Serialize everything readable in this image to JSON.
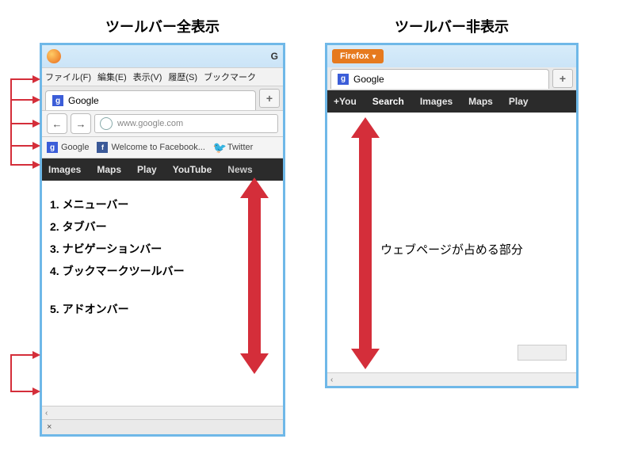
{
  "headings": {
    "left": "ツールバー全表示",
    "right": "ツールバー非表示"
  },
  "leftWindow": {
    "titlebar": {
      "rightLetter": "G"
    },
    "menubar": [
      "ファイル(F)",
      "編集(E)",
      "表示(V)",
      "履歴(S)",
      "ブックマーク"
    ],
    "tab": {
      "label": "Google",
      "newTab": "+"
    },
    "navbar": {
      "back": "←",
      "forward": "→",
      "url": "www.google.com"
    },
    "bookmarks": [
      {
        "icon": "g",
        "label": "Google"
      },
      {
        "icon": "fb",
        "label": "Welcome to Facebook..."
      },
      {
        "icon": "tw",
        "label": "Twitter"
      }
    ],
    "blackbar": [
      "Images",
      "Maps",
      "Play",
      "YouTube",
      "News"
    ],
    "annotations": [
      "1. メニューバー",
      "2. タブバー",
      "3. ナビゲーションバー",
      "4. ブックマークツールバー",
      "5. アドオンバー"
    ],
    "addonbar": {
      "close": "×"
    },
    "scroll": {
      "left": "‹"
    }
  },
  "rightWindow": {
    "ffButton": "Firefox",
    "tab": {
      "label": "Google",
      "newTab": "+"
    },
    "blackbar": [
      "+You",
      "Search",
      "Images",
      "Maps",
      "Play"
    ],
    "caption": "ウェブページが占める部分",
    "scroll": {
      "left": "‹"
    }
  }
}
